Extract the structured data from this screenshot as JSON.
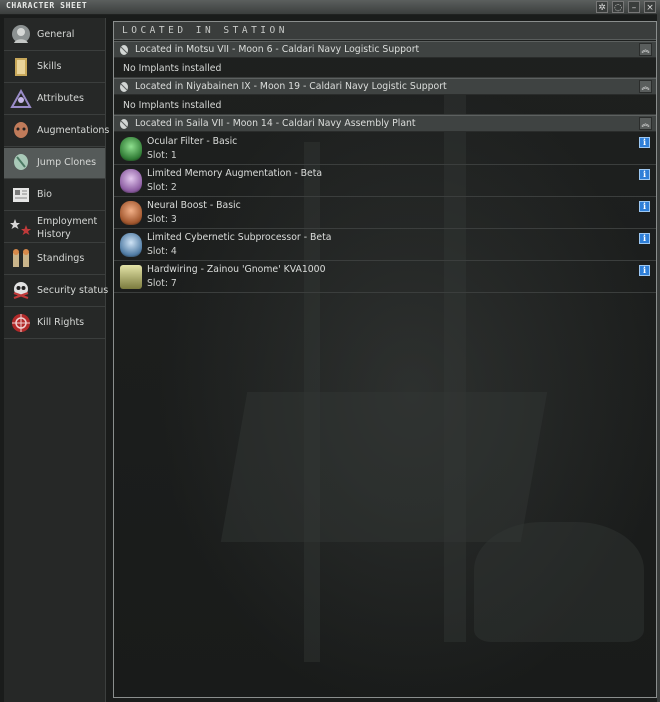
{
  "window": {
    "title": "CHARACTER SHEET",
    "controls": [
      "✲",
      "◌",
      "–",
      "×"
    ]
  },
  "nav": {
    "items": [
      {
        "label": "General",
        "icon": "general-icon",
        "active": false
      },
      {
        "label": "Skills",
        "icon": "skills-icon",
        "active": false
      },
      {
        "label": "Attributes",
        "icon": "attributes-icon",
        "active": false
      },
      {
        "label": "Augmentations",
        "icon": "augmentations-icon",
        "active": false
      },
      {
        "label": "Jump Clones",
        "icon": "jump-clones-icon",
        "active": true
      },
      {
        "label": "Bio",
        "icon": "bio-icon",
        "active": false
      },
      {
        "label": "Employment History",
        "icon": "employment-history-icon",
        "active": false
      },
      {
        "label": "Standings",
        "icon": "standings-icon",
        "active": false
      },
      {
        "label": "Security status",
        "icon": "security-status-icon",
        "active": false
      },
      {
        "label": "Kill Rights",
        "icon": "kill-rights-icon",
        "active": false
      }
    ]
  },
  "main": {
    "header": "LOCATED IN STATION",
    "groups": [
      {
        "title": "Located in Motsu VII - Moon 6 - Caldari Navy Logistic Support",
        "empty_text": "No Implants installed"
      },
      {
        "title": "Located in Niyabainen IX - Moon 19 - Caldari Navy Logistic Support",
        "empty_text": "No Implants installed"
      },
      {
        "title": "Located in Saila VII - Moon 14 - Caldari Navy Assembly Plant",
        "implants": [
          {
            "name": "Ocular Filter - Basic",
            "slot": "Slot: 1",
            "color": "#4fae52"
          },
          {
            "name": "Limited Memory Augmentation - Beta",
            "slot": "Slot: 2",
            "color": "#b98fc8"
          },
          {
            "name": "Neural Boost - Basic",
            "slot": "Slot: 3",
            "color": "#d58a5a"
          },
          {
            "name": "Limited Cybernetic Subprocessor - Beta",
            "slot": "Slot: 4",
            "color": "#8fb4d6"
          },
          {
            "name": "Hardwiring - Zainou 'Gnome' KVA1000",
            "slot": "Slot: 7",
            "color": "#b8b86e"
          }
        ]
      }
    ]
  },
  "colors": {
    "accent_info": "#2f7fd8",
    "active_nav": "#555a59"
  }
}
